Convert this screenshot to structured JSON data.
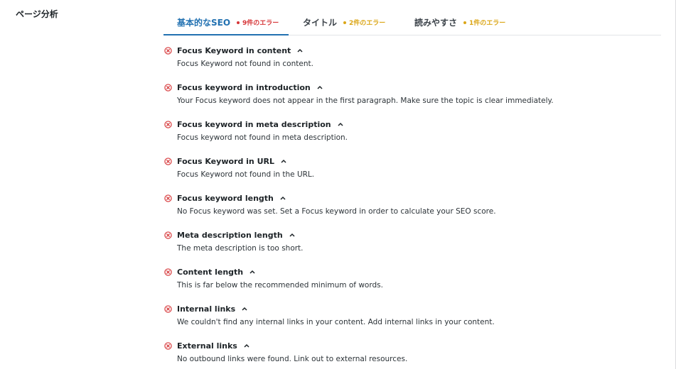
{
  "section": {
    "label": "ページ分析"
  },
  "tabs": [
    {
      "label": "基本的なSEO",
      "count": "9件のエラー",
      "count_color": "#d63638",
      "active": true
    },
    {
      "label": "タイトル",
      "count": "2件のエラー",
      "count_color": "#dba617",
      "active": false
    },
    {
      "label": "読みやすさ",
      "count": "1件のエラー",
      "count_color": "#dba617",
      "active": false
    }
  ],
  "checks": [
    {
      "title": "Focus Keyword in content",
      "description": "Focus Keyword not found in content."
    },
    {
      "title": "Focus keyword in introduction",
      "description": "Your Focus keyword does not appear in the first paragraph. Make sure the topic is clear immediately."
    },
    {
      "title": "Focus keyword in meta description",
      "description": "Focus keyword not found in meta description."
    },
    {
      "title": "Focus Keyword in URL",
      "description": "Focus Keyword not found in the URL."
    },
    {
      "title": "Focus keyword length",
      "description": "No Focus keyword was set. Set a Focus keyword in order to calculate your SEO score."
    },
    {
      "title": "Meta description length",
      "description": "The meta description is too short."
    },
    {
      "title": "Content length",
      "description": "This is far below the recommended minimum of words."
    },
    {
      "title": "Internal links",
      "description": "We couldn't find any internal links in your content. Add internal links in your content."
    },
    {
      "title": "External links",
      "description": "No outbound links were found. Link out to external resources."
    }
  ],
  "icons": {
    "error": "error-circle-icon",
    "expand": "chevron-up-icon"
  },
  "colors": {
    "accent": "#2271b1",
    "error": "#d63638",
    "warning": "#dba617"
  }
}
